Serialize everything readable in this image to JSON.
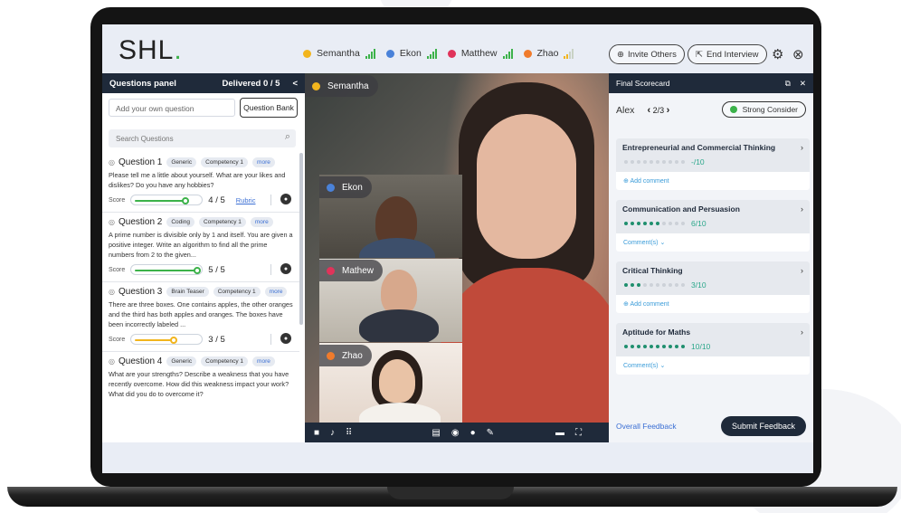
{
  "header": {
    "logo": "SHL",
    "logo_dot": ".",
    "participants": [
      {
        "name": "Semantha",
        "color": "#f2b51d",
        "signal": "good"
      },
      {
        "name": "Ekon",
        "color": "#4a82d9",
        "signal": "good"
      },
      {
        "name": "Matthew",
        "color": "#e0335a",
        "signal": "good"
      },
      {
        "name": "Zhao",
        "color": "#f07b2c",
        "signal": "low"
      }
    ],
    "invite_label": "Invite Others",
    "end_label": "End Interview",
    "icons": [
      "gear-icon",
      "close-circle-icon",
      "plus-circle-icon",
      "exit-icon"
    ]
  },
  "questions_panel": {
    "title": "Questions panel",
    "delivered": "Delivered 0 / 5",
    "collapse": "<",
    "add_placeholder": "Add your own question",
    "bank_label": "Question Bank",
    "search_placeholder": "Search Questions",
    "score_label": "Score",
    "rubric_label": "Rubric",
    "questions": [
      {
        "title": "Question 1",
        "tags": [
          "Generic",
          "Competency 1",
          "more"
        ],
        "text": "Please tell me a little about yourself. What are your likes and dislikes? Do you have any hobbies?",
        "score": "4 / 5",
        "score_fraction": 0.8,
        "color": "#3cb24a",
        "rubric": true
      },
      {
        "title": "Question 2",
        "tags": [
          "Coding",
          "Competency 1",
          "more"
        ],
        "text": "A prime number is divisible only by 1 and itself. You are given a positive integer. Write an algorithm to find all the prime numbers from 2 to the given...",
        "score": "5 / 5",
        "score_fraction": 1.0,
        "color": "#3cb24a",
        "rubric": false
      },
      {
        "title": "Question 3",
        "tags": [
          "Brain Teaser",
          "Competency 1",
          "more"
        ],
        "text": "There are three boxes. One contains apples, the other oranges and the third has both apples and oranges. The boxes have been incorrectly labeled ...",
        "score": "3 / 5",
        "score_fraction": 0.6,
        "color": "#f2b51d",
        "rubric": false
      },
      {
        "title": "Question 4",
        "tags": [
          "Generic",
          "Competency 1",
          "more"
        ],
        "text": "What are your strengths? Describe a weakness that you have recently overcome. How did this weakness impact your work? What did you do to overcome it?",
        "score": null,
        "rubric": false
      }
    ]
  },
  "video": {
    "main_name": "Semantha",
    "main_color": "#f2b51d",
    "tiles": [
      {
        "name": "Ekon",
        "color": "#4a82d9"
      },
      {
        "name": "Mathew",
        "color": "#e0335a"
      },
      {
        "name": "Zhao",
        "color": "#f07b2c"
      }
    ],
    "toolbar_icons": [
      "camera-icon",
      "mic-icon",
      "keypad-icon",
      "document-icon",
      "settings-icon",
      "chat-icon",
      "notes-icon",
      "captions-icon",
      "fullscreen-icon"
    ]
  },
  "scorecard": {
    "title": "Final Scorecard",
    "candidate": "Alex",
    "page": "2/3",
    "recommendation": "Strong Consider",
    "recommendation_color": "#3cb24a",
    "competencies": [
      {
        "name": "Entrepreneurial and Commercial Thinking",
        "value": "-/10",
        "filled": 0,
        "footer": "Add comment"
      },
      {
        "name": "Communication and Persuasion",
        "value": "6/10",
        "filled": 6,
        "footer": "Comment(s)"
      },
      {
        "name": "Critical Thinking",
        "value": "3/10",
        "filled": 3,
        "footer": "Add comment"
      },
      {
        "name": "Aptitude for Maths",
        "value": "10/10",
        "filled": 10,
        "footer": "Comment(s)"
      }
    ],
    "overall_feedback": "Overall Feedback",
    "submit_label": "Submit Feedback"
  }
}
